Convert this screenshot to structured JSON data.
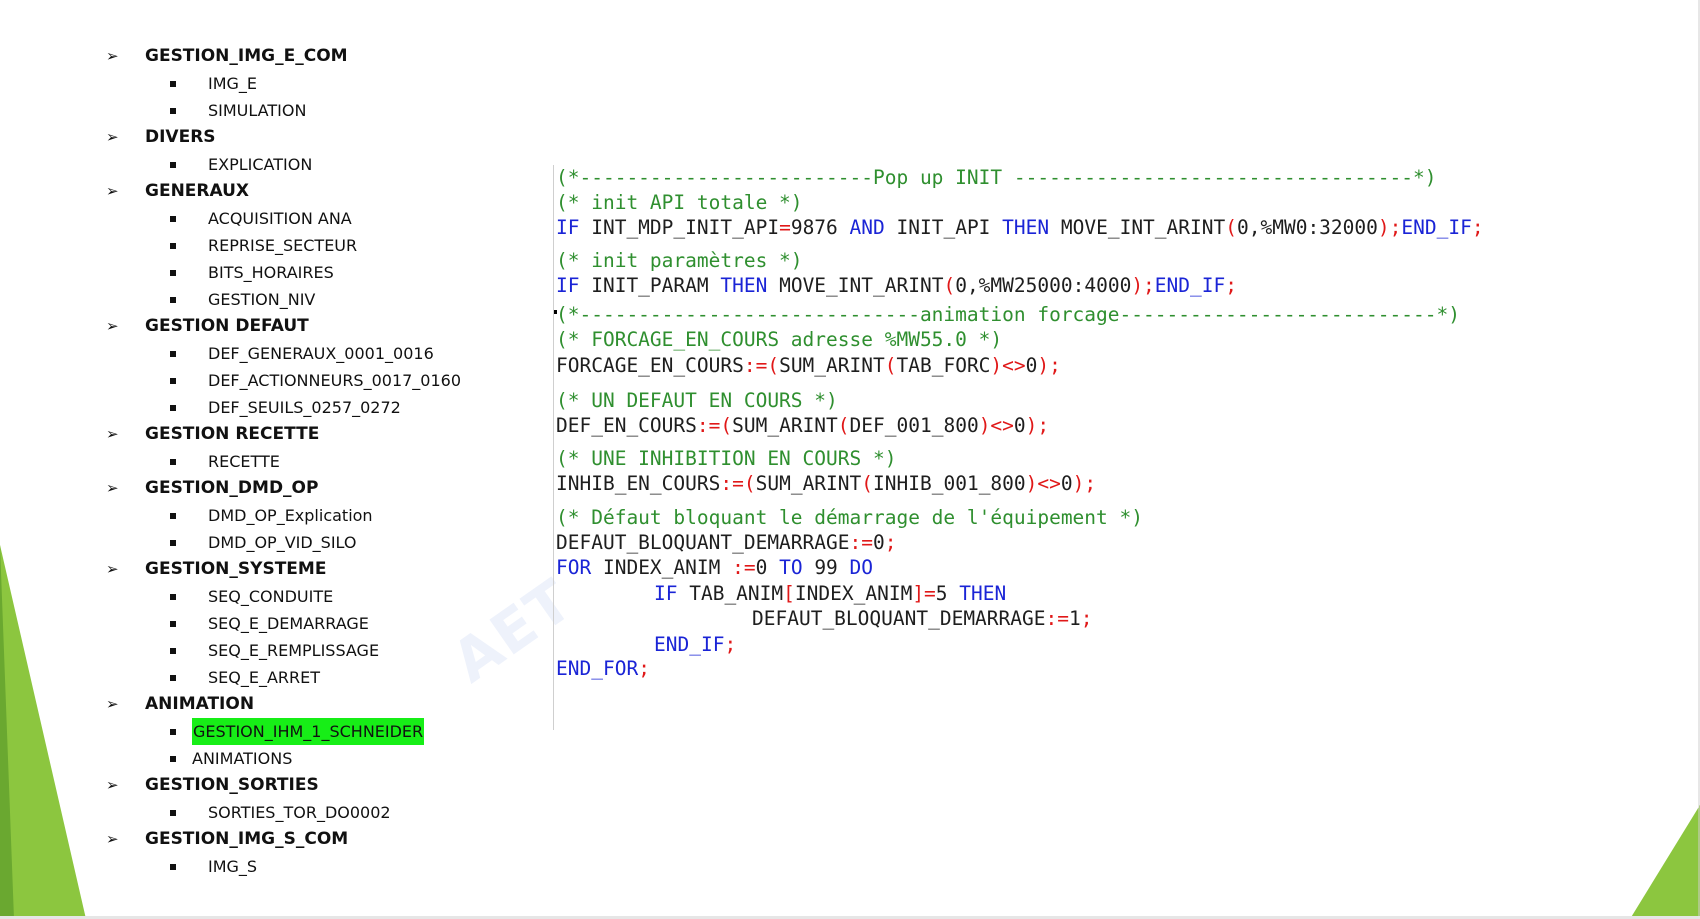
{
  "outline": [
    {
      "title": "GESTION_IMG_E_COM",
      "items": [
        "IMG_E",
        "SIMULATION"
      ]
    },
    {
      "title": "DIVERS",
      "items": [
        "EXPLICATION"
      ]
    },
    {
      "title": "GENERAUX",
      "items": [
        "ACQUISITION ANA",
        "REPRISE_SECTEUR",
        "BITS_HORAIRES",
        "GESTION_NIV"
      ]
    },
    {
      "title": "GESTION DEFAUT",
      "items": [
        "DEF_GENERAUX_0001_0016",
        "DEF_ACTIONNEURS_0017_0160",
        "DEF_SEUILS_0257_0272"
      ]
    },
    {
      "title": "GESTION RECETTE",
      "items": [
        "RECETTE"
      ]
    },
    {
      "title": "GESTION_DMD_OP",
      "items": [
        "DMD_OP_Explication",
        "DMD_OP_VID_SILO"
      ]
    },
    {
      "title": "GESTION_SYSTEME",
      "items": [
        "SEQ_CONDUITE",
        "SEQ_E_DEMARRAGE",
        "SEQ_E_REMPLISSAGE",
        "SEQ_E_ARRET"
      ]
    },
    {
      "title": "ANIMATION",
      "items": [
        "GESTION_IHM_1_SCHNEIDER",
        "ANIMATIONS"
      ],
      "highlighted_item": "GESTION_IHM_1_SCHNEIDER"
    },
    {
      "title": "GESTION_SORTIES",
      "items": [
        "SORTIES_TOR_DO0002"
      ]
    },
    {
      "title": "GESTION_IMG_S_COM",
      "items": [
        "IMG_S"
      ]
    }
  ],
  "watermark": "AET",
  "code": {
    "lines": [
      {
        "indent": 0,
        "tokens": [
          {
            "t": "(*-------------------------Pop up INIT ----------------------------------*)",
            "c": "cm"
          }
        ]
      },
      {
        "indent": 0,
        "tokens": [
          {
            "t": "(* init API totale *)",
            "c": "cm"
          }
        ]
      },
      {
        "indent": 0,
        "tokens": [
          {
            "t": "IF",
            "c": "kw"
          },
          {
            "t": " INT_MDP_INIT_API",
            "c": "tx"
          },
          {
            "t": "=",
            "c": "op"
          },
          {
            "t": "9876 ",
            "c": "num"
          },
          {
            "t": "AND",
            "c": "kw"
          },
          {
            "t": " INIT_API ",
            "c": "tx"
          },
          {
            "t": "THEN",
            "c": "kw"
          },
          {
            "t": " MOVE_INT_ARINT",
            "c": "tx"
          },
          {
            "t": "(",
            "c": "op"
          },
          {
            "t": "0,%MW0:32000",
            "c": "num"
          },
          {
            "t": ");",
            "c": "op"
          },
          {
            "t": "END_IF",
            "c": "kw"
          },
          {
            "t": ";",
            "c": "op"
          }
        ]
      },
      {
        "indent": 0,
        "tokens": [
          {
            "t": "(* init paramètres *)",
            "c": "cm"
          }
        ]
      },
      {
        "indent": 0,
        "tokens": [
          {
            "t": "IF",
            "c": "kw"
          },
          {
            "t": " INIT_PARAM ",
            "c": "tx"
          },
          {
            "t": "THEN",
            "c": "kw"
          },
          {
            "t": " MOVE_INT_ARINT",
            "c": "tx"
          },
          {
            "t": "(",
            "c": "op"
          },
          {
            "t": "0,%MW25000:4000",
            "c": "num"
          },
          {
            "t": ");",
            "c": "op"
          },
          {
            "t": "END_IF",
            "c": "kw"
          },
          {
            "t": ";",
            "c": "op"
          }
        ]
      },
      {
        "indent": 0,
        "tokens": [
          {
            "t": "(*-----------------------------animation forcage---------------------------*)",
            "c": "cm"
          }
        ]
      },
      {
        "indent": 0,
        "tokens": [
          {
            "t": "(* FORCAGE_EN_COURS adresse %MW55.0 *)",
            "c": "cm"
          }
        ]
      },
      {
        "indent": 0,
        "tokens": [
          {
            "t": "FORCAGE_EN_COURS",
            "c": "tx"
          },
          {
            "t": ":=(",
            "c": "op"
          },
          {
            "t": "SUM_ARINT",
            "c": "tx"
          },
          {
            "t": "(",
            "c": "op"
          },
          {
            "t": "TAB_FORC",
            "c": "tx"
          },
          {
            "t": ")<>",
            "c": "op"
          },
          {
            "t": "0",
            "c": "num"
          },
          {
            "t": ");",
            "c": "op"
          }
        ]
      },
      {
        "indent": 0,
        "tokens": [
          {
            "t": "(* UN DEFAUT EN COURS *)",
            "c": "cm"
          }
        ]
      },
      {
        "indent": 0,
        "tokens": [
          {
            "t": "DEF_EN_COURS",
            "c": "tx"
          },
          {
            "t": ":=(",
            "c": "op"
          },
          {
            "t": "SUM_ARINT",
            "c": "tx"
          },
          {
            "t": "(",
            "c": "op"
          },
          {
            "t": "DEF_001_800",
            "c": "tx"
          },
          {
            "t": ")<>",
            "c": "op"
          },
          {
            "t": "0",
            "c": "num"
          },
          {
            "t": ");",
            "c": "op"
          }
        ]
      },
      {
        "indent": 0,
        "tokens": [
          {
            "t": "(* UNE INHIBITION EN COURS *)",
            "c": "cm"
          }
        ]
      },
      {
        "indent": 0,
        "tokens": [
          {
            "t": "INHIB_EN_COURS",
            "c": "tx"
          },
          {
            "t": ":=(",
            "c": "op"
          },
          {
            "t": "SUM_ARINT",
            "c": "tx"
          },
          {
            "t": "(",
            "c": "op"
          },
          {
            "t": "INHIB_001_800",
            "c": "tx"
          },
          {
            "t": ")<>",
            "c": "op"
          },
          {
            "t": "0",
            "c": "num"
          },
          {
            "t": ");",
            "c": "op"
          }
        ]
      },
      {
        "indent": 0,
        "tokens": [
          {
            "t": "(* Défaut bloquant le démarrage de l'équipement *)",
            "c": "cm"
          }
        ]
      },
      {
        "indent": 0,
        "tokens": [
          {
            "t": "DEFAUT_BLOQUANT_DEMARRAGE",
            "c": "tx"
          },
          {
            "t": ":=",
            "c": "op"
          },
          {
            "t": "0",
            "c": "num"
          },
          {
            "t": ";",
            "c": "op"
          }
        ]
      },
      {
        "indent": 0,
        "tokens": [
          {
            "t": "FOR",
            "c": "kw"
          },
          {
            "t": " INDEX_ANIM ",
            "c": "tx"
          },
          {
            "t": ":=",
            "c": "op"
          },
          {
            "t": "0 ",
            "c": "num"
          },
          {
            "t": "TO",
            "c": "kw"
          },
          {
            "t": " 99 ",
            "c": "num"
          },
          {
            "t": "DO",
            "c": "kw"
          }
        ]
      },
      {
        "indent": 1,
        "tokens": [
          {
            "t": "IF",
            "c": "kw"
          },
          {
            "t": " TAB_ANIM",
            "c": "tx"
          },
          {
            "t": "[",
            "c": "op"
          },
          {
            "t": "INDEX_ANIM",
            "c": "tx"
          },
          {
            "t": "]=",
            "c": "op"
          },
          {
            "t": "5 ",
            "c": "num"
          },
          {
            "t": "THEN",
            "c": "kw"
          }
        ]
      },
      {
        "indent": 2,
        "tokens": [
          {
            "t": "DEFAUT_BLOQUANT_DEMARRAGE",
            "c": "tx"
          },
          {
            "t": ":=",
            "c": "op"
          },
          {
            "t": "1",
            "c": "num"
          },
          {
            "t": ";",
            "c": "op"
          }
        ]
      },
      {
        "indent": 1,
        "tokens": [
          {
            "t": "END_IF",
            "c": "kw"
          },
          {
            "t": ";",
            "c": "op"
          }
        ]
      },
      {
        "indent": 0,
        "tokens": [
          {
            "t": "END_FOR",
            "c": "kw"
          },
          {
            "t": ";",
            "c": "op"
          }
        ]
      }
    ]
  },
  "colors": {
    "accent_green": "#8cc63f",
    "highlight": "#17ee17",
    "keyword": "#1a24d6",
    "comment": "#2f8f2f",
    "operator": "#e01818"
  }
}
